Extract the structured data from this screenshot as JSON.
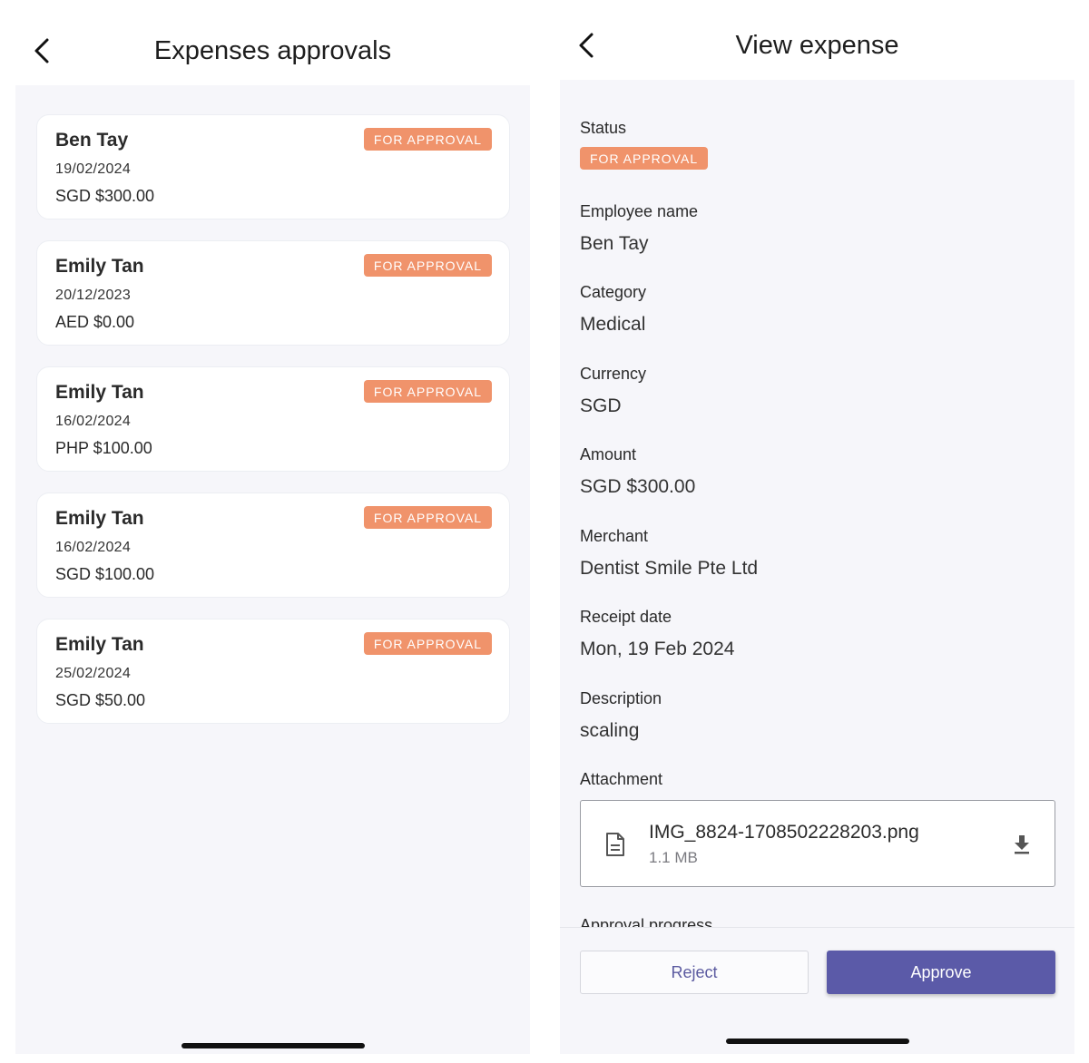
{
  "left_screen": {
    "title": "Expenses approvals",
    "cards": [
      {
        "name": "Ben Tay",
        "date": "19/02/2024",
        "amount": "SGD $300.00",
        "status": "FOR APPROVAL"
      },
      {
        "name": "Emily Tan",
        "date": "20/12/2023",
        "amount": "AED $0.00",
        "status": "FOR APPROVAL"
      },
      {
        "name": "Emily Tan",
        "date": "16/02/2024",
        "amount": "PHP $100.00",
        "status": "FOR APPROVAL"
      },
      {
        "name": "Emily Tan",
        "date": "16/02/2024",
        "amount": "SGD $100.00",
        "status": "FOR APPROVAL"
      },
      {
        "name": "Emily Tan",
        "date": "25/02/2024",
        "amount": "SGD $50.00",
        "status": "FOR APPROVAL"
      }
    ]
  },
  "right_screen": {
    "title": "View expense",
    "status": {
      "label": "Status",
      "value": "FOR APPROVAL"
    },
    "employee_name": {
      "label": "Employee name",
      "value": "Ben Tay"
    },
    "category": {
      "label": "Category",
      "value": "Medical"
    },
    "currency": {
      "label": "Currency",
      "value": "SGD"
    },
    "amount": {
      "label": "Amount",
      "value": "SGD $300.00"
    },
    "merchant": {
      "label": "Merchant",
      "value": "Dentist Smile Pte Ltd"
    },
    "receipt_date": {
      "label": "Receipt date",
      "value": "Mon, 19 Feb 2024"
    },
    "description": {
      "label": "Description",
      "value": "scaling"
    },
    "attachment": {
      "label": "Attachment",
      "file_name": "IMG_8824-1708502228203.png",
      "file_size": "1.1 MB"
    },
    "approval_progress_label": "Approval progress",
    "reject_label": "Reject",
    "approve_label": "Approve"
  },
  "colors": {
    "accent": "#5b5aa8",
    "badge": "#f0936b",
    "background": "#f6f6fa"
  },
  "icons": {
    "back": "chevron-left-icon",
    "file": "document-icon",
    "download": "download-icon"
  }
}
